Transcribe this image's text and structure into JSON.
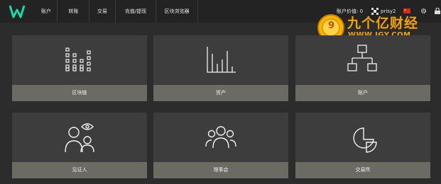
{
  "nav": {
    "items": [
      "账户",
      "转账",
      "交易",
      "充值/提现",
      "区块浏览器"
    ]
  },
  "status": {
    "account_value_label": "账户价值:",
    "account_value": "0",
    "username": "prisy2"
  },
  "watermark": {
    "brand": "九个亿财经",
    "url": "WWW.JGY.COM",
    "coin_mark": "9"
  },
  "cards": [
    {
      "label": "区块链",
      "icon": "blocks-icon"
    },
    {
      "label": "资产",
      "icon": "bar-chart-icon"
    },
    {
      "label": "账户",
      "icon": "hierarchy-icon"
    },
    {
      "label": "见证人",
      "icon": "witness-icon"
    },
    {
      "label": "理事会",
      "icon": "group-icon"
    },
    {
      "label": "交易所",
      "icon": "pie-chart-icon"
    }
  ],
  "colors": {
    "accent": "#20d6a8",
    "label_bar": "#6b6a63",
    "card": "#3d3d3d",
    "watermark": "#f5a300"
  }
}
